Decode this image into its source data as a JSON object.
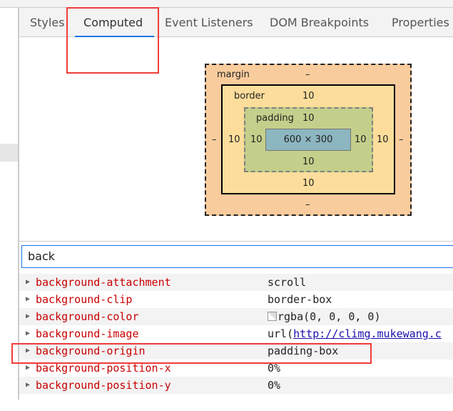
{
  "tabs": [
    "Styles",
    "Computed",
    "Event Listeners",
    "DOM Breakpoints",
    "Properties"
  ],
  "active_tab": "Computed",
  "box_model": {
    "margin_label": "margin",
    "margin_top": "–",
    "margin_bottom": "–",
    "margin_left": "–",
    "margin_right": "–",
    "border_label": "border",
    "border_top": "10",
    "border_bottom": "10",
    "border_left": "10",
    "border_right": "10",
    "padding_label": "padding",
    "padding_top": "10",
    "padding_bottom": "10",
    "padding_left": "10",
    "padding_right": "10",
    "content": "600 × 300",
    "colors": {
      "margin": "#f9cc9d",
      "border": "#fddd9b",
      "padding": "#c3cf8a",
      "content": "#8cb6c0"
    }
  },
  "filter": {
    "value": "back"
  },
  "properties": [
    {
      "name": "background-attachment",
      "value": "scroll"
    },
    {
      "name": "background-clip",
      "value": "border-box"
    },
    {
      "name": "background-color",
      "value": "rgba(0, 0, 0, 0)"
    },
    {
      "name": "background-image",
      "value_prefix": "url(",
      "link": "http://climg.mukewang.c"
    },
    {
      "name": "background-origin",
      "value": "padding-box"
    },
    {
      "name": "background-position-x",
      "value": "0%"
    },
    {
      "name": "background-position-y",
      "value": "0%"
    }
  ],
  "highlight_color": "#f03c3c"
}
